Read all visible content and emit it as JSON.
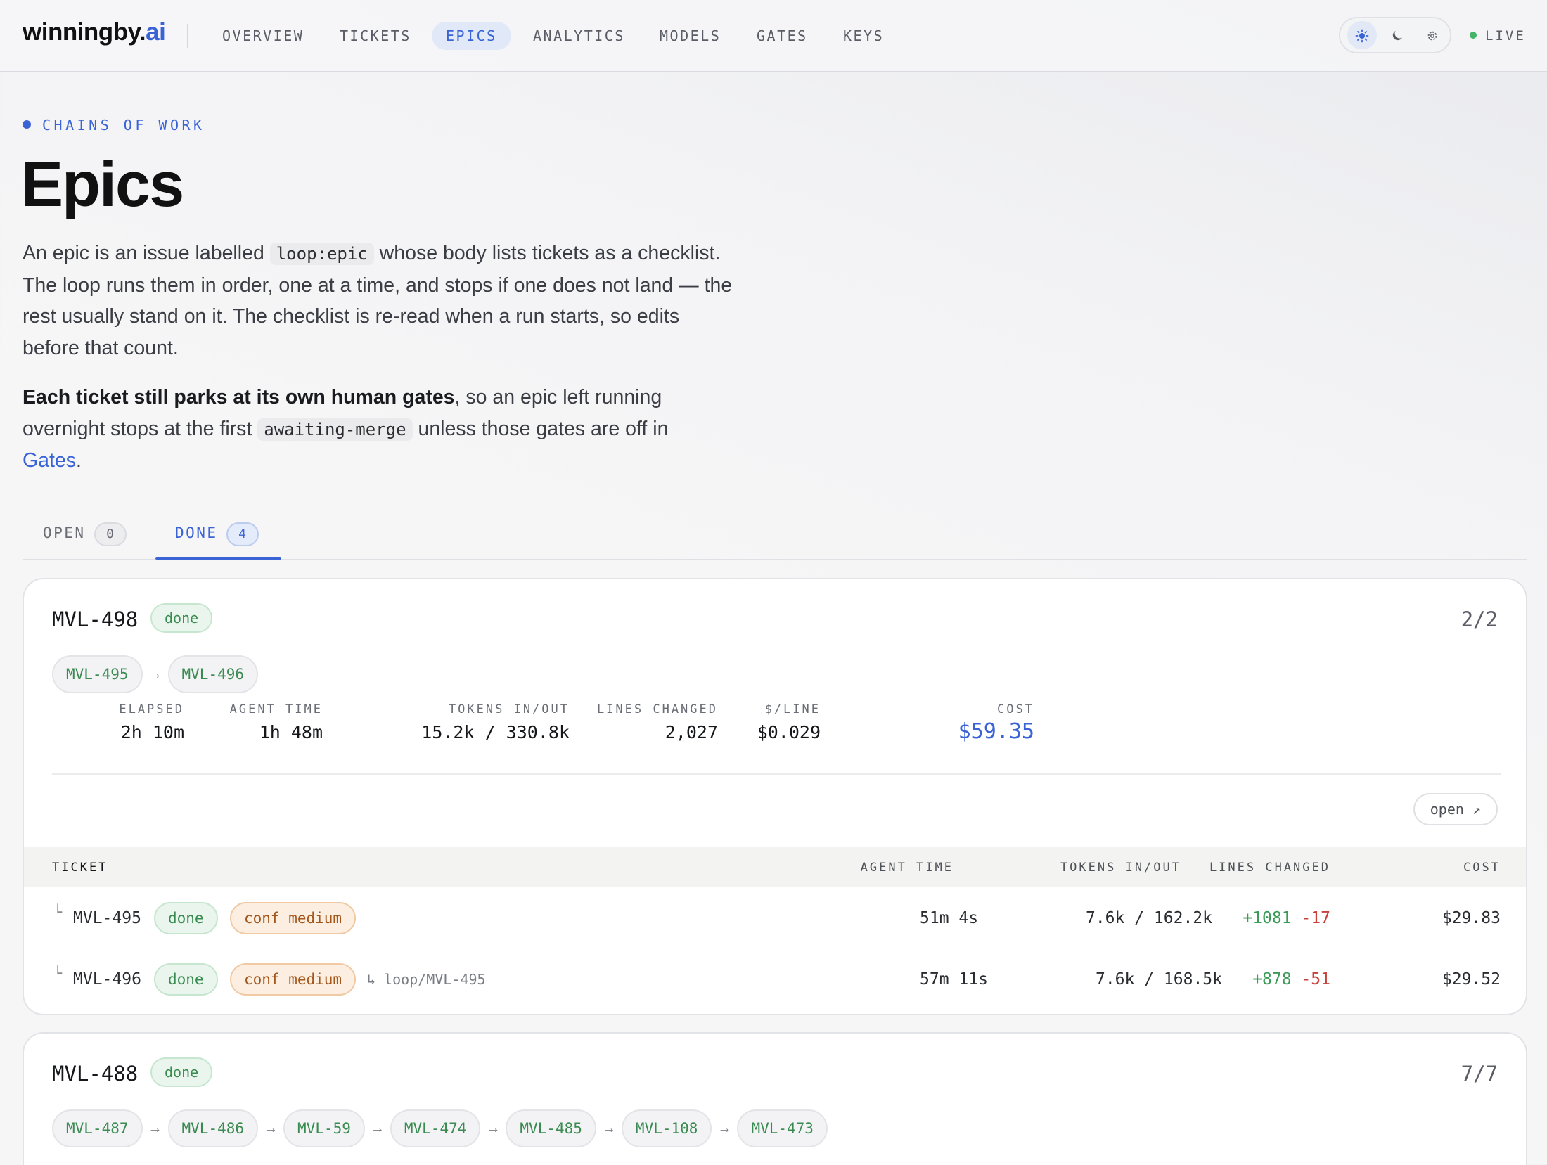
{
  "nav": {
    "brand_main": "winningby.",
    "brand_accent": "ai",
    "items": [
      {
        "label": "OVERVIEW"
      },
      {
        "label": "TICKETS"
      },
      {
        "label": "EPICS"
      },
      {
        "label": "ANALYTICS"
      },
      {
        "label": "MODELS"
      },
      {
        "label": "GATES"
      },
      {
        "label": "KEYS"
      }
    ],
    "active_item": "EPICS",
    "theme_icons": [
      "sun-icon",
      "moon-icon",
      "gear-icon"
    ],
    "active_theme": "light",
    "live_label": "LIVE",
    "accent_color": "#3a63d6",
    "live_color": "#46b36a"
  },
  "header": {
    "eyebrow": "CHAINS OF WORK",
    "title": "Epics",
    "p1_a": "An epic is an issue labelled ",
    "p1_code": "loop:epic",
    "p1_b": " whose body lists tickets as a checklist. The loop runs them in order, one at a time, and stops if one does not land — the rest usually stand on it. The checklist is re-read when a run starts, so edits before that count.",
    "p2_bold": "Each ticket still parks at its own human gates",
    "p2_a": ", so an epic left running overnight stops at the first ",
    "p2_code": "awaiting-merge",
    "p2_b": " unless those gates are off in ",
    "p2_link": "Gates",
    "p2_end": "."
  },
  "tabs": [
    {
      "label": "OPEN",
      "count": "0"
    },
    {
      "label": "DONE",
      "count": "4"
    }
  ],
  "active_tab": "DONE",
  "epics": [
    {
      "id": "MVL-498",
      "status": "done",
      "progress": "2/2",
      "chain": [
        "MVL-495",
        "MVL-496"
      ],
      "stats": {
        "elapsed_label": "ELAPSED",
        "elapsed": "2h 10m",
        "agent_label": "AGENT TIME",
        "agent": "1h 48m",
        "tokens_label": "TOKENS IN/OUT",
        "tokens": "15.2k / 330.8k",
        "lines_label": "LINES CHANGED",
        "lines": "2,027",
        "perline_label": "$/LINE",
        "perline": "$0.029",
        "cost_label": "COST",
        "cost": "$59.35"
      },
      "open_label": "open ↗",
      "table": {
        "headers": [
          "TICKET",
          "AGENT TIME",
          "TOKENS IN/OUT",
          "LINES CHANGED",
          "COST"
        ],
        "rows": [
          {
            "tree": "└",
            "id": "MVL-495",
            "status": "done",
            "conf": "conf medium",
            "branch": "",
            "agent": "51m 4s",
            "tokens": "7.6k / 162.2k",
            "plus": "+1081",
            "minus": "-17",
            "cost": "$29.83"
          },
          {
            "tree": "└",
            "id": "MVL-496",
            "status": "done",
            "conf": "conf medium",
            "branch": "↳ loop/MVL-495",
            "agent": "57m 11s",
            "tokens": "7.6k / 168.5k",
            "plus": "+878",
            "minus": "-51",
            "cost": "$29.52"
          }
        ]
      }
    },
    {
      "id": "MVL-488",
      "status": "done",
      "progress": "7/7",
      "chain": [
        "MVL-487",
        "MVL-486",
        "MVL-59",
        "MVL-474",
        "MVL-485",
        "MVL-108",
        "MVL-473"
      ]
    }
  ]
}
